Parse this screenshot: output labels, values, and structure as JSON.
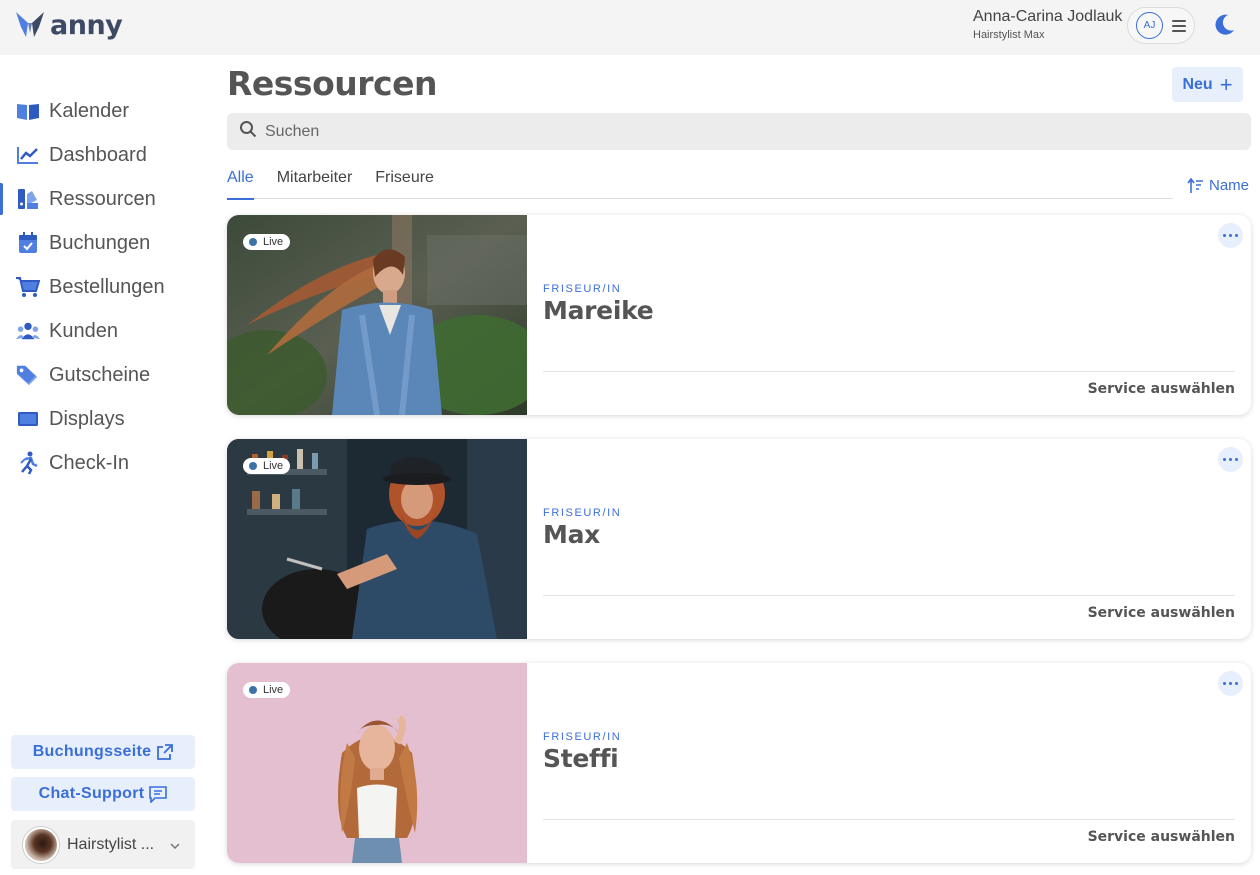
{
  "brand": {
    "name": "anny",
    "accent": "#3a6fd8"
  },
  "user": {
    "name": "Anna-Carina Jodlauk",
    "role": "Hairstylist Max",
    "initials": "AJ"
  },
  "icons": {
    "theme_toggle": "moon-icon",
    "menu": "hamburger-icon",
    "search": "search-icon",
    "sort": "sort-ascending-icon",
    "external": "external-link-icon",
    "chat": "chat-icon",
    "chevron": "chevron-down-icon",
    "more": "more-dots-icon"
  },
  "sidebar": {
    "items": [
      {
        "label": "Kalender",
        "icon": "book-icon"
      },
      {
        "label": "Dashboard",
        "icon": "trend-chart-icon"
      },
      {
        "label": "Ressourcen",
        "icon": "resources-icon",
        "active": true
      },
      {
        "label": "Buchungen",
        "icon": "calendar-check-icon"
      },
      {
        "label": "Bestellungen",
        "icon": "cart-icon"
      },
      {
        "label": "Kunden",
        "icon": "users-icon"
      },
      {
        "label": "Gutscheine",
        "icon": "tags-icon"
      },
      {
        "label": "Displays",
        "icon": "monitor-icon"
      },
      {
        "label": "Check-In",
        "icon": "running-person-icon"
      }
    ],
    "booking_page_label": "Buchungsseite",
    "chat_support_label": "Chat-Support",
    "profile_label": "Hairstylist ..."
  },
  "main": {
    "title": "Ressourcen",
    "new_button_label": "Neu",
    "search_placeholder": "Suchen",
    "tabs": [
      {
        "label": "Alle",
        "active": true
      },
      {
        "label": "Mitarbeiter"
      },
      {
        "label": "Friseure"
      }
    ],
    "sort_label": "Name"
  },
  "resources": [
    {
      "status": "Live",
      "role": "FRISEUR/IN",
      "name": "Mareike",
      "action": "Service auswählen"
    },
    {
      "status": "Live",
      "role": "FRISEUR/IN",
      "name": "Max",
      "action": "Service auswählen"
    },
    {
      "status": "Live",
      "role": "FRISEUR/IN",
      "name": "Steffi",
      "action": "Service auswählen"
    }
  ]
}
